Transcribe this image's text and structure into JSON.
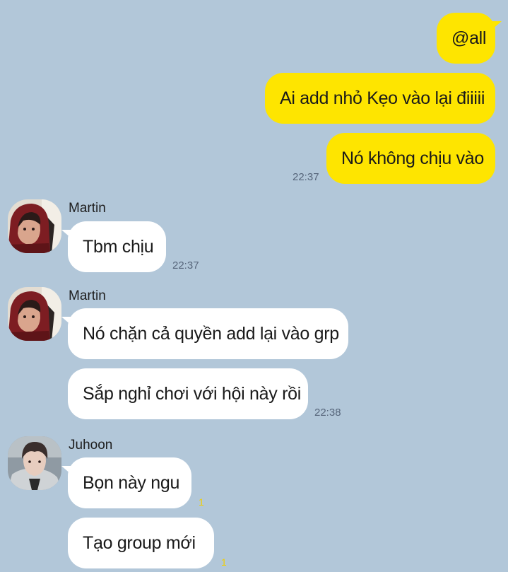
{
  "theme": {
    "background": "#b2c7d9",
    "outgoing_bubble": "#fee500",
    "incoming_bubble": "#ffffff",
    "unread_color": "#f2cf00"
  },
  "messages": {
    "out1": "@all",
    "out2": "Ai add nhỏ Kẹo vào lại điiiii",
    "out3": "Nó không chịu vào",
    "out_time": "22:37",
    "g1_sender": "Martin",
    "g1_msg1": "Tbm chịu",
    "g1_time": "22:37",
    "g2_sender": "Martin",
    "g2_msg1": "Nó chặn cả quyền add lại vào grp",
    "g2_msg2": "Sắp nghỉ chơi với hội này rồi",
    "g2_time": "22:38",
    "g3_sender": "Juhoon",
    "g3_msg1": "Bọn này ngu",
    "g3_unread1": "1",
    "g3_msg2": "Tạo group mới",
    "g3_unread2": "1"
  },
  "icons": {
    "martin_avatar": "profile-photo-red-hood",
    "juhoon_avatar": "profile-photo-young-man"
  }
}
